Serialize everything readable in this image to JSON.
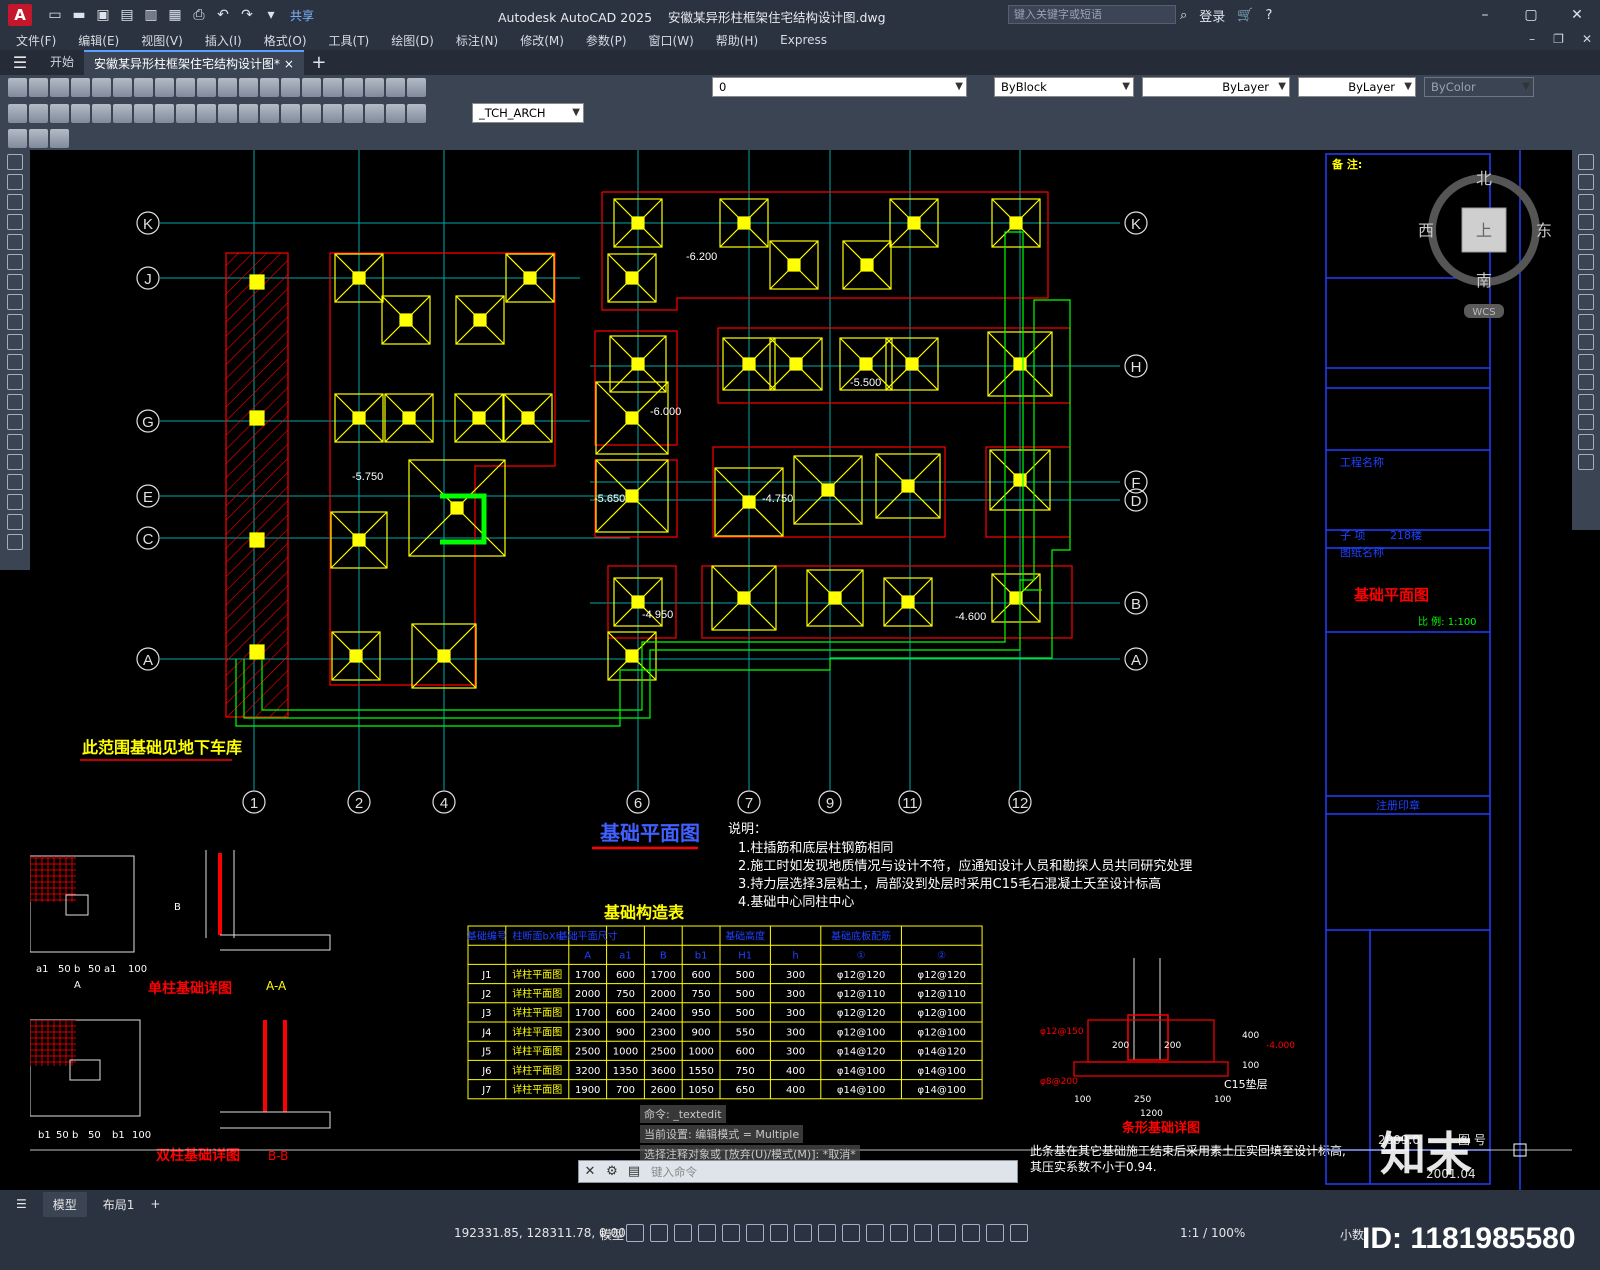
{
  "titlebar": {
    "app_letter": "A",
    "share": "共享",
    "title": "Autodesk AutoCAD 2025    安徽某异形柱框架住宅结构设计图.dwg",
    "search_placeholder": "键入关键字或短语",
    "signin": "登录"
  },
  "menu": [
    "文件(F)",
    "编辑(E)",
    "视图(V)",
    "插入(I)",
    "格式(O)",
    "工具(T)",
    "绘图(D)",
    "标注(N)",
    "修改(M)",
    "参数(P)",
    "窗口(W)",
    "帮助(H)",
    "Express"
  ],
  "tabs": {
    "start": "开始",
    "doc": "安徽某异形柱框架住宅结构设计图*",
    "close": "×",
    "add": "+"
  },
  "toolbar": {
    "layer": "0",
    "color": "ByBlock",
    "linetype": "ByLayer",
    "lineweight": "ByLayer",
    "plotstyle": "ByColor",
    "textstyle": "_TCH_ARCH"
  },
  "viewcube": {
    "north": "北",
    "south": "南",
    "east": "东",
    "west": "西",
    "top": "上",
    "wcs": "WCS"
  },
  "drawing": {
    "grid_rows": [
      "K",
      "J",
      "H",
      "G",
      "F",
      "E",
      "D",
      "C",
      "B",
      "A",
      "A",
      "K"
    ],
    "grid_cols": [
      "1",
      "2",
      "4",
      "6",
      "7",
      "9",
      "11",
      "12"
    ],
    "elevations": [
      "-6.200",
      "-6.000",
      "-5.500",
      "-5.750",
      "-5.650",
      "-4.750",
      "-4.950",
      "-4.600",
      "-4.000"
    ],
    "note_garage": "此范围基础见地下车库",
    "plan_title": "基础平面图",
    "notes_title": "说明：",
    "notes": [
      "1.柱插筋和底层柱钢筋相同",
      "2.施工时如发现地质情况与设计不符，应通知设计人员和勘探人员共同研究处理",
      "3.持力层选择3层粘土，局部没到处层时采用C15毛石混凝土夭至设计标高",
      "4.基础中心同柱中心"
    ],
    "table_title": "基础构造表",
    "table_headers": [
      "基础编号",
      "柱断面bXh",
      "基础平面尺寸",
      "",
      "",
      "",
      "基础高度",
      "",
      "基础底板配筋",
      ""
    ],
    "table_subheaders": [
      "",
      "",
      "A",
      "a1",
      "B",
      "b1",
      "H1",
      "h",
      "①",
      "②"
    ],
    "table_rows": [
      [
        "J1",
        "详柱平面图",
        "1700",
        "600",
        "1700",
        "600",
        "500",
        "300",
        "φ12@120",
        "φ12@120"
      ],
      [
        "J2",
        "详柱平面图",
        "2000",
        "750",
        "2000",
        "750",
        "500",
        "300",
        "φ12@110",
        "φ12@110"
      ],
      [
        "J3",
        "详柱平面图",
        "1700",
        "600",
        "2400",
        "950",
        "500",
        "300",
        "φ12@120",
        "φ12@100"
      ],
      [
        "J4",
        "详柱平面图",
        "2300",
        "900",
        "2300",
        "900",
        "550",
        "300",
        "φ12@100",
        "φ12@100"
      ],
      [
        "J5",
        "详柱平面图",
        "2500",
        "1000",
        "2500",
        "1000",
        "600",
        "300",
        "φ14@120",
        "φ14@120"
      ],
      [
        "J6",
        "详柱平面图",
        "3200",
        "1350",
        "3600",
        "1550",
        "750",
        "400",
        "φ14@100",
        "φ14@100"
      ],
      [
        "J7",
        "详柱平面图",
        "1900",
        "700",
        "2600",
        "1050",
        "650",
        "400",
        "φ14@100",
        "φ14@100"
      ]
    ],
    "detail_single": "单柱基础详图",
    "detail_double": "双柱基础详图",
    "section_aa": "A-A",
    "section_bb": "B-B",
    "detail_strip": "条形基础详图",
    "c15_label": "C15垫层",
    "strip_dims": [
      "100",
      "250",
      "1200",
      "100",
      "400",
      "100",
      "200",
      "200"
    ],
    "strip_rebar": [
      "φ12@150",
      "φ8@200"
    ],
    "strip_note_1": "此条基在其它基础施工结束后采用素土压实回填至设计标高,",
    "strip_note_2": "其压实系数不小于0.94.",
    "dim_labels": [
      "a1",
      "50",
      "b",
      "50",
      "a1",
      "100",
      "A",
      "B",
      "b1",
      "50",
      "b",
      "50",
      "b1",
      "100"
    ],
    "titleblock": {
      "notes": "备 注:",
      "project": "工程名称",
      "sub_item": "子 项",
      "sub_item_value": "218楼",
      "drawing_name": "图纸名称",
      "drawing_title": "基础平面图",
      "scale": "比 例: 1:100",
      "stamp": "注册印章",
      "date": "2001.04",
      "drawing_no_label": "图 号",
      "drawing_no": "2009.0"
    }
  },
  "command": {
    "history": [
      "命令: _textedit",
      "当前设置: 编辑模式 = Multiple",
      "选择注释对象或 [放弃(U)/模式(M)]: *取消*"
    ],
    "placeholder": "键入命令"
  },
  "layout_tabs": [
    "模型",
    "布局1"
  ],
  "status": {
    "coords": "192331.85, 128311.78, 0.00",
    "model": "模型",
    "scale": "1:1 / 100%",
    "units": "小数"
  },
  "brand": {
    "logo": "知末",
    "id": "ID: 1181985580"
  },
  "colors": {
    "yellow": "#ffff00",
    "red": "#ff0000",
    "green": "#00ff00",
    "cyan": "#00ffff",
    "grid": "#00b0b0"
  }
}
